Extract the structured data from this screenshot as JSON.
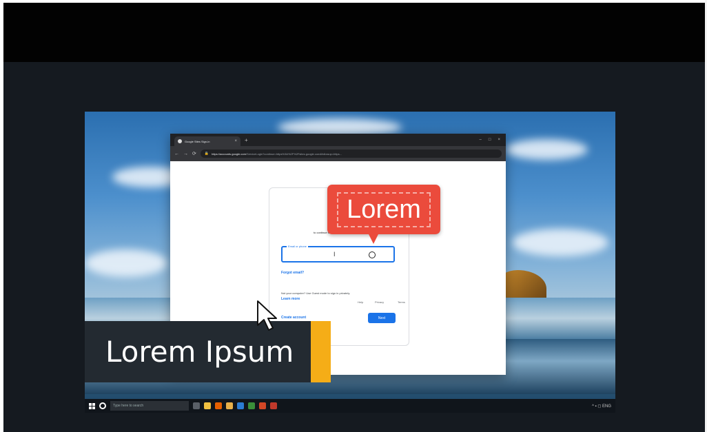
{
  "browser": {
    "tab_title": "Google Sites Sign-in",
    "tab_close": "×",
    "new_tab": "+",
    "window_controls": [
      "–",
      "□",
      "×"
    ],
    "url_secure": "https://accounts.google.com",
    "url_rest": "/ServiceLogin?continue=https%3A%2F%2Fsites.google.com&followup=https...",
    "nav_icons": [
      "←",
      "→",
      "⟳"
    ]
  },
  "signin": {
    "heading": "to continue to Sites",
    "email_label": "Email or phone",
    "email_value": "",
    "forgot_email": "Forgot email?",
    "guest_note": "Not your computer? Use Guest mode to sign in privately.",
    "learn_more": "Learn more",
    "create_account": "Create account",
    "next_button": "Next",
    "footer": [
      "Help",
      "Privacy",
      "Terms"
    ]
  },
  "overlay": {
    "callout_text": "Lorem",
    "lower_third_text": "Lorem Ipsum",
    "callout_color": "#eb4b3c",
    "accent_color": "#f5ad17"
  },
  "taskbar": {
    "search_placeholder": "Type here to search",
    "tray_text": "^ ▪ ◻ ENG"
  },
  "icons": [
    "windows-logo-icon",
    "cortana-icon",
    "mouse-pointer-icon",
    "text-cursor-icon",
    "lock-icon"
  ]
}
